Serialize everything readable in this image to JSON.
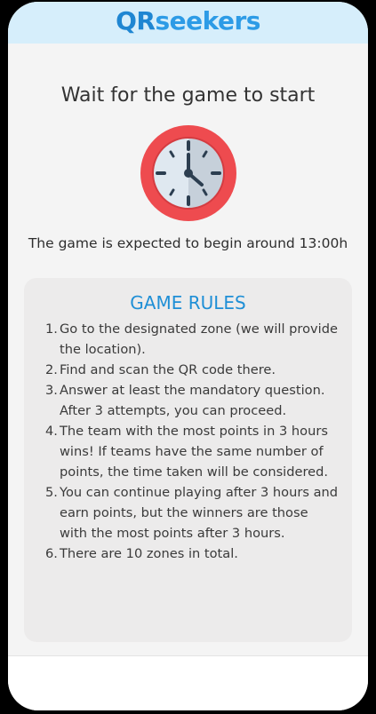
{
  "header": {
    "logo_qr": "QR",
    "logo_seekers": "seekers"
  },
  "main": {
    "title": "Wait for the game to start",
    "clock_icon": "clock-icon",
    "expected_text": "The game is expected to begin around 13:00h"
  },
  "rules": {
    "title": "GAME RULES",
    "items": [
      {
        "num": "1.",
        "text": "Go to the designated zone (we will provide the location)."
      },
      {
        "num": "2.",
        "text": "Find and scan the QR code there."
      },
      {
        "num": "3.",
        "text": "Answer at least the mandatory question. After 3 attempts, you can proceed."
      },
      {
        "num": "4.",
        "text": "The team with the most points in 3 hours wins! If teams have the same number of points, the time taken will be considered."
      },
      {
        "num": "5.",
        "text": "You can continue playing after 3 hours and earn points, but the winners are those with the most points after 3 hours."
      },
      {
        "num": "6.",
        "text": "There are 10 zones in total."
      }
    ]
  },
  "colors": {
    "header_bg": "#d6eefb",
    "brand_blue": "#1f8fd6",
    "clock_red": "#ee4b4f"
  }
}
